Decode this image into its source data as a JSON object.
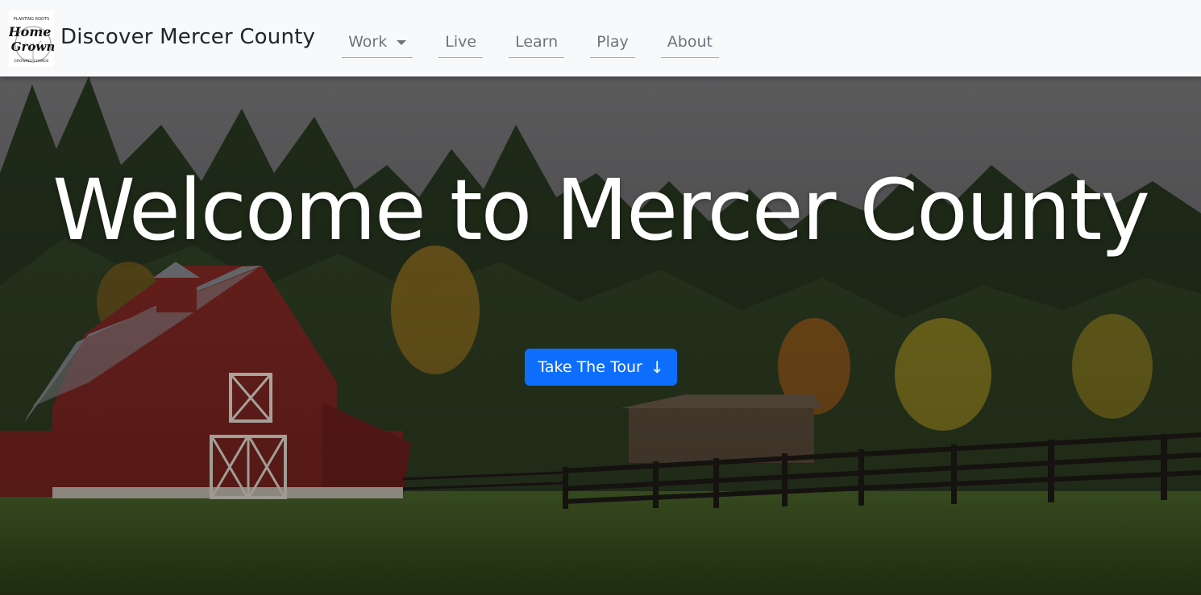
{
  "navbar": {
    "logo_text": {
      "top": "PLANTING ROOTS",
      "line1": "Home",
      "line2": "Grown",
      "bottom": "GROWING CHANGE"
    },
    "brand": "Discover Mercer County",
    "items": [
      {
        "label": "Work",
        "dropdown": true
      },
      {
        "label": "Live"
      },
      {
        "label": "Learn"
      },
      {
        "label": "Play"
      },
      {
        "label": "About"
      }
    ]
  },
  "hero": {
    "title": "Welcome to Mercer County",
    "button_label": "Take The Tour",
    "button_icon": "arrow-down-icon",
    "button_arrow": "↓"
  },
  "colors": {
    "accent": "#0d6efd",
    "navbar_bg": "#f8f9fa",
    "barn_red": "#8a2a26"
  }
}
